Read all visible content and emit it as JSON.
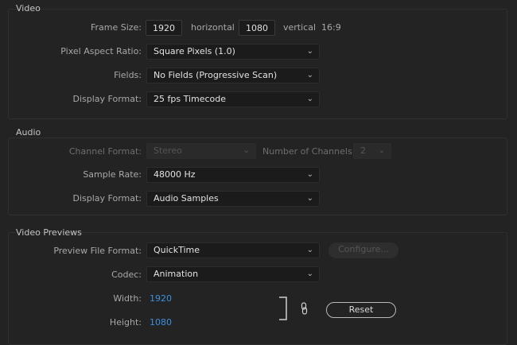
{
  "video": {
    "title": "Video",
    "frame_size_label": "Frame Size:",
    "frame_width": "1920",
    "horizontal_label": "horizontal",
    "frame_height": "1080",
    "vertical_label": "vertical",
    "aspect": "16:9",
    "pixel_aspect_label": "Pixel Aspect Ratio:",
    "pixel_aspect_value": "Square Pixels (1.0)",
    "fields_label": "Fields:",
    "fields_value": "No Fields (Progressive Scan)",
    "display_format_label": "Display Format:",
    "display_format_value": "25 fps Timecode"
  },
  "audio": {
    "title": "Audio",
    "channel_format_label": "Channel Format:",
    "channel_format_value": "Stereo",
    "num_channels_label": "Number of Channels:",
    "num_channels_value": "2",
    "sample_rate_label": "Sample Rate:",
    "sample_rate_value": "48000 Hz",
    "display_format_label": "Display Format:",
    "display_format_value": "Audio Samples"
  },
  "previews": {
    "title": "Video Previews",
    "file_format_label": "Preview File Format:",
    "file_format_value": "QuickTime",
    "configure_label": "Configure...",
    "codec_label": "Codec:",
    "codec_value": "Animation",
    "width_label": "Width:",
    "width_value": "1920",
    "height_label": "Height:",
    "height_value": "1080",
    "reset_label": "Reset"
  },
  "icons": {
    "dropdown": "chevron-down-icon",
    "link": "link-icon",
    "bracket": "constrain-bracket"
  }
}
